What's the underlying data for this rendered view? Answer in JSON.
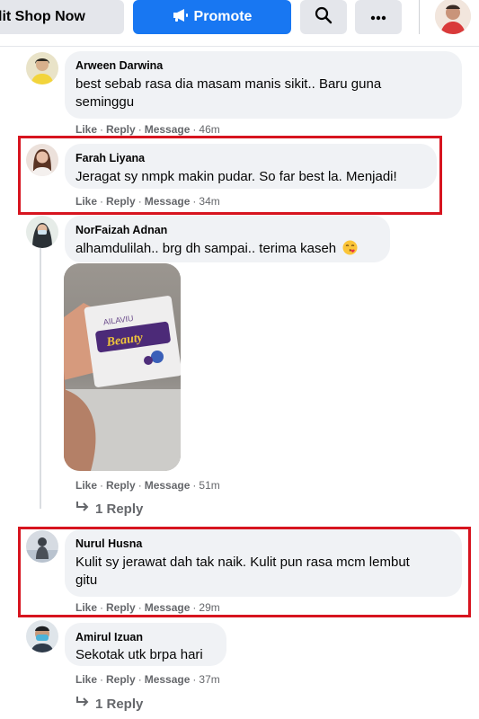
{
  "toolbar": {
    "shop_label": "lit Shop Now",
    "promote_label": "Promote",
    "search_icon": "search-icon",
    "more_icon": "more-dots-icon"
  },
  "actions": {
    "like": "Like",
    "reply": "Reply",
    "message": "Message",
    "separator": "·"
  },
  "comments": [
    {
      "name": "Arween Darwina",
      "text_lines": [
        "best sebab rasa dia masam manis sikit.. Baru guna",
        "seminggu"
      ],
      "time": "46m"
    },
    {
      "name": "Farah Liyana",
      "text_lines": [
        "Jeragat sy nmpk makin pudar. So far best la. Menjadi!"
      ],
      "time": "34m",
      "highlighted": true
    },
    {
      "name": "NorFaizah Adnan",
      "text_lines": [
        "alhamdulilah.. brg dh sampai.. terima kaseh"
      ],
      "emoji": "face-blowing-kiss-emoji",
      "time": "51m",
      "attachment": {
        "brand_text": "AILAVIU",
        "product_text": "Beauty"
      },
      "replies": "1 Reply"
    },
    {
      "name": "Nurul Husna",
      "text_lines": [
        "Kulit sy jerawat dah tak naik. Kulit pun rasa mcm lembut",
        "gitu"
      ],
      "time": "29m",
      "highlighted": true
    },
    {
      "name": "Amirul Izuan",
      "text_lines": [
        "Sekotak utk brpa hari"
      ],
      "time": "37m",
      "replies": "1 Reply"
    }
  ],
  "colors": {
    "accent": "#1877f2",
    "highlight": "#d7141f",
    "bubble": "#f0f2f5",
    "muted_text": "#65676b"
  }
}
